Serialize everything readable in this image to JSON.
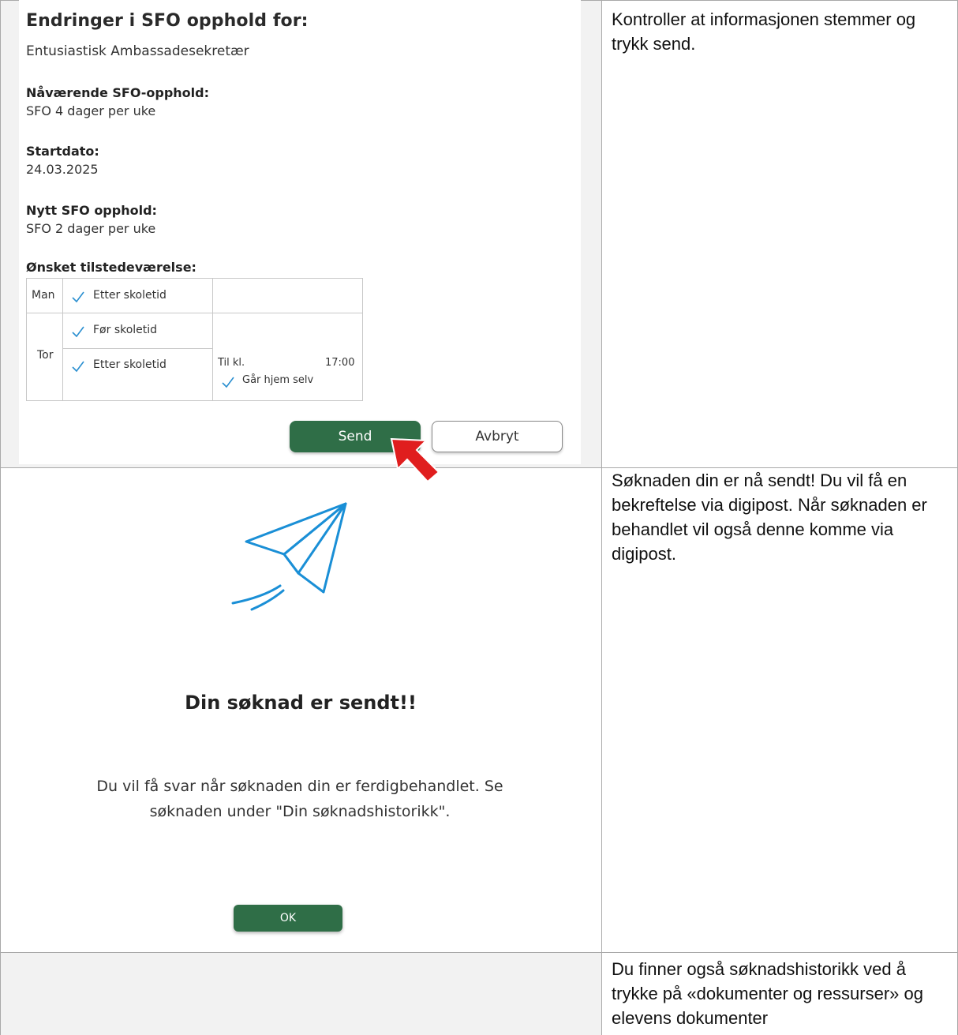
{
  "form": {
    "title": "Endringer i SFO opphold for:",
    "student_name": "Entusiastisk Ambassadesekretær",
    "current_label": "Nåværende SFO-opphold:",
    "current_value": "SFO 4 dager per uke",
    "start_label": "Startdato:",
    "start_value": "24.03.2025",
    "new_label": "Nytt SFO opphold:",
    "new_value": "SFO 2 dager per uke",
    "attendance_label": "Ønsket tilstedeværelse:",
    "attendance": {
      "day1": "Man",
      "day1_slot": "Etter skoletid",
      "day2": "Tor",
      "day2_slot1": "Før skoletid",
      "day2_slot2": "Etter skoletid",
      "until_label": "Til kl.",
      "until_time": "17:00",
      "walk_home": "Går hjem selv"
    },
    "send_label": "Send",
    "cancel_label": "Avbryt"
  },
  "instructions": {
    "step1": "Kontroller at informasjonen stemmer og trykk send.",
    "step2": "Søknaden din er nå sendt! Du vil få en bekreftelse via digipost. Når søknaden er behandlet vil også denne komme via digipost.",
    "step3": "Du finner også søknadshistorikk ved å trykke på «dokumenter og ressurser» og elevens dokumenter"
  },
  "success": {
    "title": "Din søknad er sendt!!",
    "message": "Du vil få svar når søknaden din er ferdigbehandlet. Se søknaden under \"Din søknadshistorikk\".",
    "ok_label": "OK"
  },
  "colors": {
    "primary_green": "#2f6e47",
    "plane_blue": "#1a8fd6",
    "cursor_red": "#e01e1e"
  }
}
